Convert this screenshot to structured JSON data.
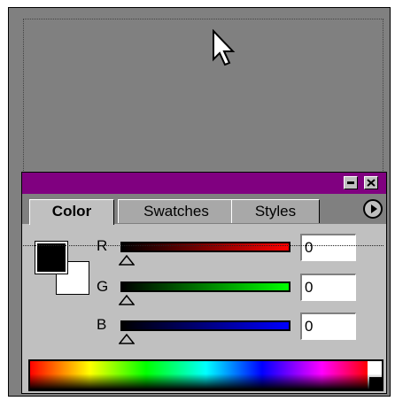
{
  "panel": {
    "tabs": [
      {
        "label": "Color",
        "active": true
      },
      {
        "label": "Swatches",
        "active": false
      },
      {
        "label": "Styles",
        "active": false
      }
    ],
    "titlebar_color": "#800080"
  },
  "channels": [
    {
      "label": "R",
      "value": "0",
      "slider_fraction": 0,
      "color": "#ff0000"
    },
    {
      "label": "G",
      "value": "0",
      "slider_fraction": 0,
      "color": "#00ff00"
    },
    {
      "label": "B",
      "value": "0",
      "slider_fraction": 0,
      "color": "#0000ff"
    }
  ],
  "swatches": {
    "foreground": "#000000",
    "background": "#ffffff"
  },
  "icons": [
    "arrow-cursor-icon",
    "minimize-icon",
    "close-icon",
    "panel-menu-icon",
    "slider-thumb-icon"
  ]
}
